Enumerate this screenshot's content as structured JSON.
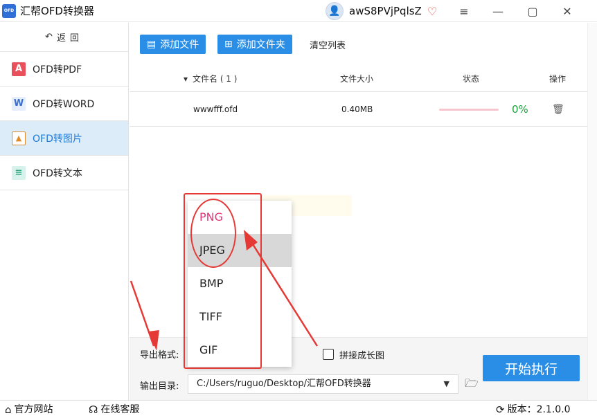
{
  "titlebar": {
    "logo_text": "OFD",
    "app_title": "汇帮OFD转换器",
    "username": "awS8PVjPqlsZ",
    "minimize": "≡",
    "restore": "—",
    "maximize": "▢",
    "close": "✕"
  },
  "sidebar": {
    "back_label": "返回",
    "items": [
      {
        "label": "OFD转PDF",
        "icon": "pdf-icon"
      },
      {
        "label": "OFD转WORD",
        "icon": "word-icon"
      },
      {
        "label": "OFD转图片",
        "icon": "image-icon",
        "active": true
      },
      {
        "label": "OFD转文本",
        "icon": "text-file-icon"
      }
    ]
  },
  "toolbar": {
    "add_file": "添加文件",
    "add_folder": "添加文件夹",
    "clear_list": "清空列表"
  },
  "table": {
    "headers": {
      "name": "文件名 ( 1 )",
      "size": "文件大小",
      "status": "状态",
      "action": "操作"
    },
    "rows": [
      {
        "name": "wwwfff.ofd",
        "size": "0.40MB",
        "progress": "0%",
        "progress_fraction": 0
      }
    ]
  },
  "format_dropdown": {
    "options": [
      "PNG",
      "JPEG",
      "BMP",
      "TIFF",
      "GIF"
    ],
    "selected": "PNG",
    "hovered": "JPEG"
  },
  "settings": {
    "format_label": "导出格式:",
    "merge_label": "拼接成长图",
    "output_label": "输出目录:",
    "output_path": "C:/Users/ruguo/Desktop/汇帮OFD转换器",
    "start_button": "开始执行"
  },
  "statusbar": {
    "website": "官方网站",
    "support": "在线客服",
    "version": "版本：2.1.0.0"
  },
  "colors": {
    "accent_blue": "#2b8ee6",
    "active_nav_bg": "#dcecf9",
    "annotation_red": "#e53935",
    "selected_option": "#e2357a",
    "progress_green": "#1aa43a"
  }
}
